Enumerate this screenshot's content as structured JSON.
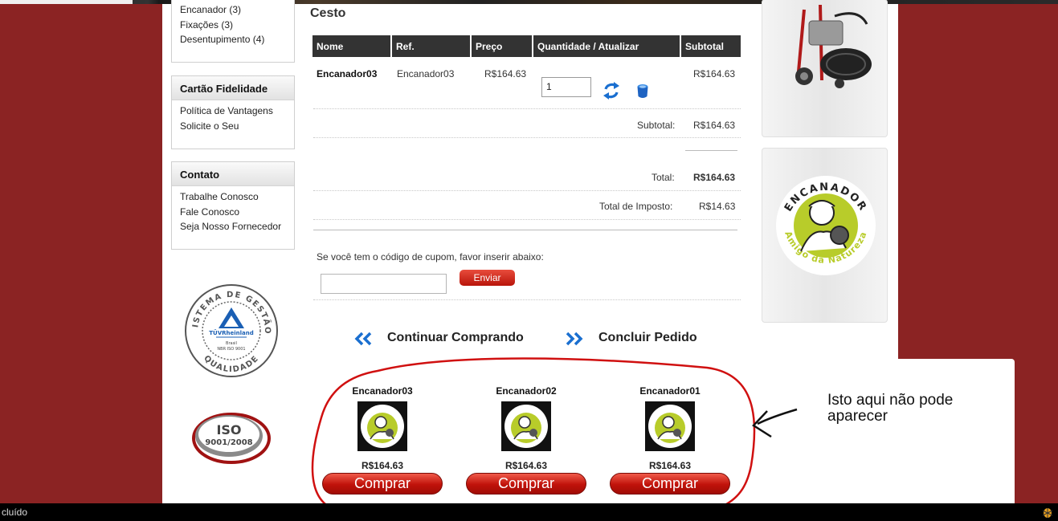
{
  "sidebar": {
    "categories": [
      "Encanador (3)",
      "Fixações (3)",
      "Desentupimento (4)"
    ],
    "loyalty": {
      "title": "Cartão Fidelidade",
      "items": [
        "Política de Vantagens",
        "Solicite o Seu"
      ]
    },
    "contact": {
      "title": "Contato",
      "items": [
        "Trabalhe Conosco",
        "Fale Conosco",
        "Seja Nosso Fornecedor"
      ]
    },
    "seal": {
      "top": "SISTEMA DE GESTÃO",
      "brand": "TÜVRheinland",
      "l1": "Brasil",
      "l2": "NBR ISO 9001",
      "bottom": "QUALIDADE"
    },
    "iso": {
      "l1": "ISO",
      "l2": "9001/2008"
    }
  },
  "cart": {
    "title": "Cesto",
    "headers": {
      "name": "Nome",
      "ref": "Ref.",
      "price": "Preço",
      "qty": "Quantidade / Atualizar",
      "subtotal": "Subtotal"
    },
    "row": {
      "name": "Encanador03",
      "ref": "Encanador03",
      "price": "R$164.63",
      "qty": "1",
      "subtotal": "R$164.63"
    },
    "subtotal_label": "Subtotal:",
    "subtotal_value": "R$164.63",
    "total_label": "Total:",
    "total_value": "R$164.63",
    "tax_label": "Total de Imposto:",
    "tax_value": "R$14.63",
    "coupon_prompt": "Se você tem o código de cupom, favor inserir abaixo:",
    "coupon_button": "Enviar",
    "continue_label": "Continuar Comprando",
    "checkout_label": "Concluir Pedido"
  },
  "related": [
    {
      "name": "Encanador03",
      "price": "R$164.63",
      "button": "Comprar"
    },
    {
      "name": "Encanador02",
      "price": "R$164.63",
      "button": "Comprar"
    },
    {
      "name": "Encanador01",
      "price": "R$164.63",
      "button": "Comprar"
    }
  ],
  "logo": {
    "top": "ENCANADOR",
    "bottom": "Amigo da Natureza"
  },
  "annotation": "Isto aqui não pode aparecer",
  "status": "cluído",
  "colors": {
    "background": "#8b2323",
    "header": "#333333",
    "button_red": "#c0120a",
    "accent_blue": "#1a6fd0",
    "logo_green": "#b8cc2a"
  }
}
